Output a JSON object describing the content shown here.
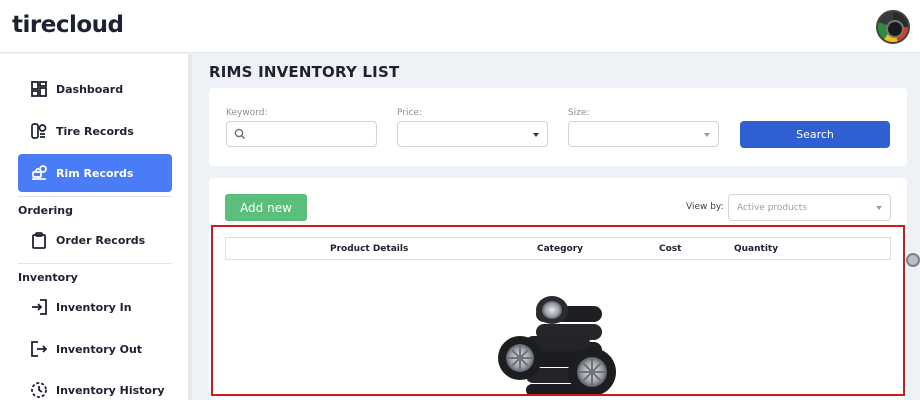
{
  "app": {
    "logo_left": "tire",
    "logo_right": "cloud"
  },
  "sidebar": {
    "items": [
      {
        "label": "Dashboard",
        "icon": "dashboard-icon"
      },
      {
        "label": "Tire Records",
        "icon": "tire-records-icon"
      },
      {
        "label": "Rim Records",
        "icon": "rim-icon",
        "active": true
      }
    ],
    "ordering_label": "Ordering",
    "ordering_items": [
      {
        "label": "Order Records",
        "icon": "clipboard-icon"
      }
    ],
    "inventory_label": "Inventory",
    "inventory_items": [
      {
        "label": "Inventory In",
        "icon": "login-icon"
      },
      {
        "label": "Inventory Out",
        "icon": "logout-icon"
      },
      {
        "label": "Inventory History",
        "icon": "history-icon"
      }
    ]
  },
  "page": {
    "title": "RIMS INVENTORY LIST"
  },
  "filters": {
    "keyword_label": "Keyword:",
    "keyword_value": "",
    "price_label": "Price:",
    "price_value": "",
    "size_label": "Size:",
    "size_value": "",
    "search_label": "Search"
  },
  "toolbar": {
    "add_label": "Add new",
    "viewby_label": "View by:",
    "viewby_value": "Active products"
  },
  "table": {
    "columns": [
      "Product Details",
      "Category",
      "Cost",
      "Quantity"
    ]
  },
  "colors": {
    "accent": "#4a7cf7",
    "search_button": "#2f5fd0",
    "add_button": "#5bbf7c",
    "highlight": "#d0191e"
  }
}
